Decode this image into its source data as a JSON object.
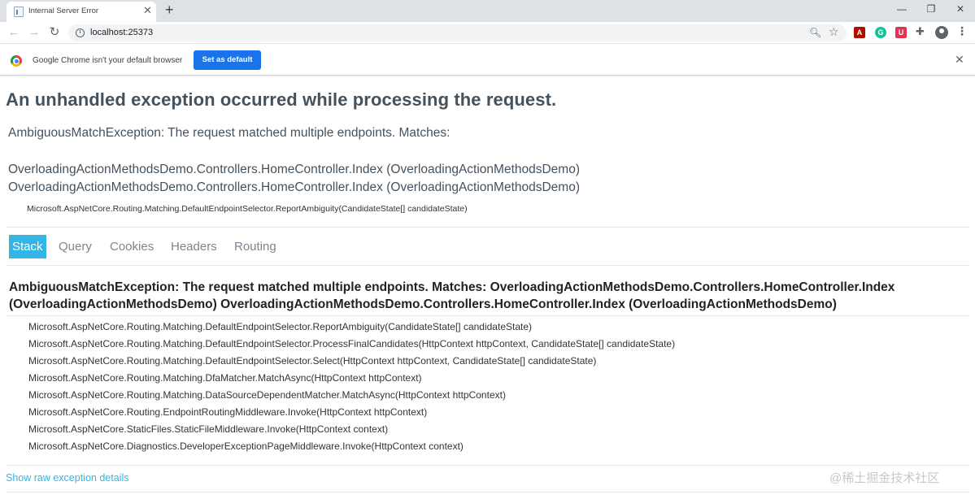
{
  "browser": {
    "tab": {
      "title": "Internal Server Error",
      "close": "✕"
    },
    "new_tab": "+",
    "window_controls": {
      "minimize": "—",
      "maximize": "❐",
      "close": "✕"
    },
    "nav": {
      "back": "←",
      "forward": "→",
      "reload": "↻"
    },
    "address": {
      "url": "localhost:25373"
    },
    "infobar": {
      "message": "Google Chrome isn't your default browser",
      "button": "Set as default",
      "close": "✕"
    },
    "extensions": [
      {
        "name": "acrobat-extension-icon",
        "glyph": "A",
        "color": "#b30b00"
      },
      {
        "name": "grammarly-extension-icon",
        "glyph": "G",
        "color": "#15c39a"
      },
      {
        "name": "pocket-extension-icon",
        "glyph": "U",
        "color": "#e0334f"
      }
    ]
  },
  "error_page": {
    "heading": "An unhandled exception occurred while processing the request.",
    "title_error": "AmbiguousMatchException: The request matched multiple endpoints. Matches:",
    "matches": [
      "OverloadingActionMethodsDemo.Controllers.HomeController.Index (OverloadingActionMethodsDemo)",
      "OverloadingActionMethodsDemo.Controllers.HomeController.Index (OverloadingActionMethodsDemo)"
    ],
    "location": "Microsoft.AspNetCore.Routing.Matching.DefaultEndpointSelector.ReportAmbiguity(CandidateState[] candidateState)",
    "tabs": [
      {
        "label": "Stack",
        "selected": true
      },
      {
        "label": "Query",
        "selected": false
      },
      {
        "label": "Cookies",
        "selected": false
      },
      {
        "label": "Headers",
        "selected": false
      },
      {
        "label": "Routing",
        "selected": false
      }
    ],
    "stack_heading": "AmbiguousMatchException: The request matched multiple endpoints. Matches: OverloadingActionMethodsDemo.Controllers.HomeController.Index (OverloadingActionMethodsDemo) OverloadingActionMethodsDemo.Controllers.HomeController.Index (OverloadingActionMethodsDemo)",
    "frames": [
      "Microsoft.AspNetCore.Routing.Matching.DefaultEndpointSelector.ReportAmbiguity(CandidateState[] candidateState)",
      "Microsoft.AspNetCore.Routing.Matching.DefaultEndpointSelector.ProcessFinalCandidates(HttpContext httpContext, CandidateState[] candidateState)",
      "Microsoft.AspNetCore.Routing.Matching.DefaultEndpointSelector.Select(HttpContext httpContext, CandidateState[] candidateState)",
      "Microsoft.AspNetCore.Routing.Matching.DfaMatcher.MatchAsync(HttpContext httpContext)",
      "Microsoft.AspNetCore.Routing.Matching.DataSourceDependentMatcher.MatchAsync(HttpContext httpContext)",
      "Microsoft.AspNetCore.Routing.EndpointRoutingMiddleware.Invoke(HttpContext httpContext)",
      "Microsoft.AspNetCore.StaticFiles.StaticFileMiddleware.Invoke(HttpContext context)",
      "Microsoft.AspNetCore.Diagnostics.DeveloperExceptionPageMiddleware.Invoke(HttpContext context)"
    ],
    "raw_link": "Show raw exception details"
  },
  "watermark": "@稀土掘金技术社区",
  "colors": {
    "accent": "#33b5e5",
    "heading": "#44525e",
    "chrome_blue": "#1a73e8"
  }
}
